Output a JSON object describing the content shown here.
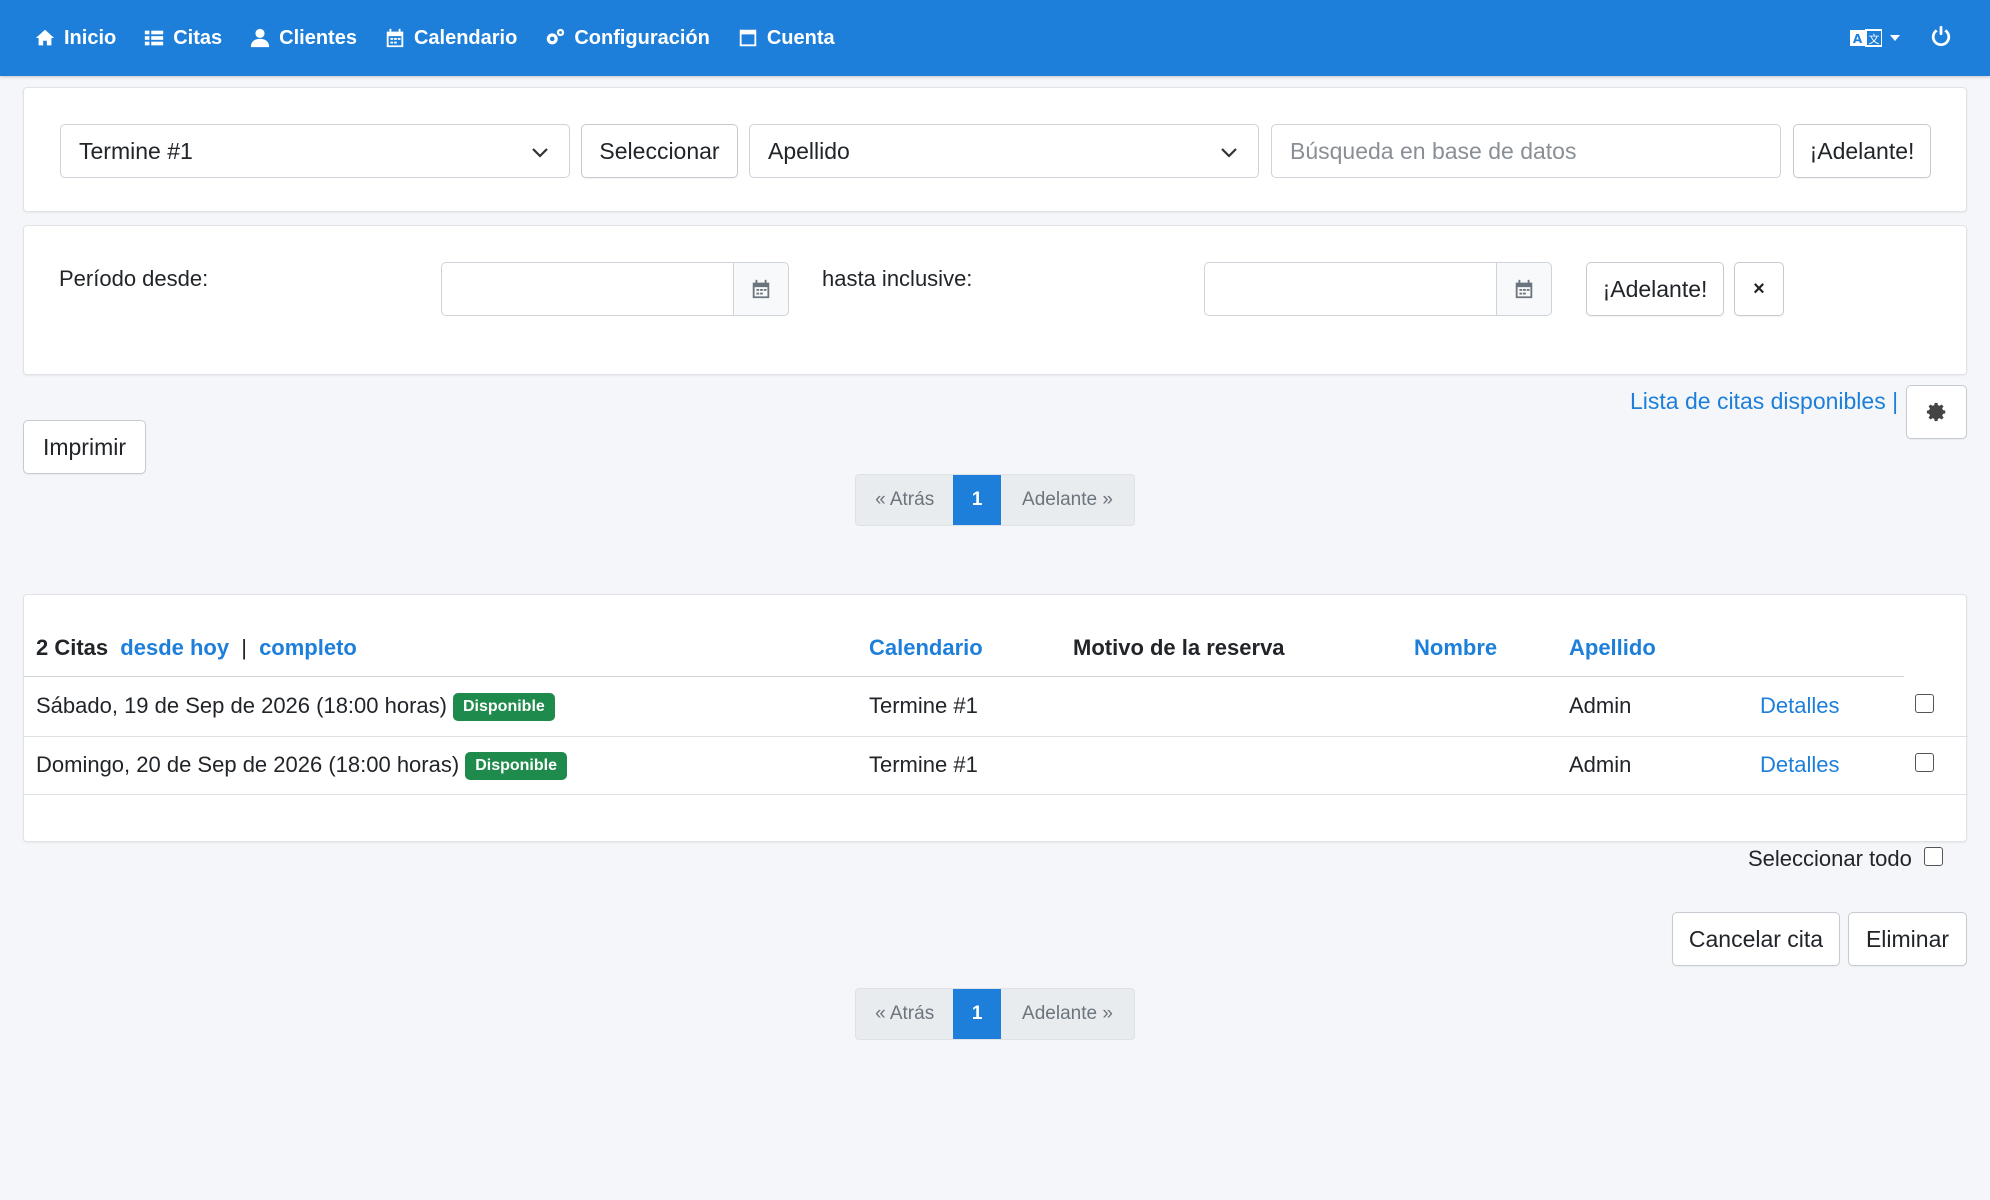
{
  "nav": {
    "items": [
      {
        "label": "Inicio",
        "icon": "home-icon"
      },
      {
        "label": "Citas",
        "icon": "list-icon"
      },
      {
        "label": "Clientes",
        "icon": "user-icon"
      },
      {
        "label": "Calendario",
        "icon": "calendar-icon"
      },
      {
        "label": "Configuración",
        "icon": "cogs-icon"
      },
      {
        "label": "Cuenta",
        "icon": "window-icon"
      }
    ],
    "language_icon": "language-icon",
    "power_icon": "power-icon"
  },
  "search": {
    "calendar_select": "Termine #1",
    "select_button": "Seleccionar",
    "field_select": "Apellido",
    "db_search_placeholder": "Búsqueda en base de datos",
    "go_button": "¡Adelante!"
  },
  "period": {
    "from_label": "Período desde:",
    "to_label": "hasta inclusive:",
    "from_value": "",
    "to_value": "",
    "go_button": "¡Adelante!",
    "clear_button": "×"
  },
  "toolbar": {
    "print_button": "Imprimir",
    "available_link": "Lista de citas disponibles",
    "separator": "|"
  },
  "pagination": {
    "prev": "« Atrás",
    "current": "1",
    "next": "Adelante »"
  },
  "table": {
    "count_label": "2 Citas",
    "filter_today": "desde hoy",
    "filter_sep": "|",
    "filter_all": "completo",
    "headers": {
      "calendar": "Calendario",
      "reason": "Motivo de la reserva",
      "name": "Nombre",
      "surname": "Apellido"
    },
    "rows": [
      {
        "date": "Sábado, 19 de Sep de 2026 (18:00 horas)",
        "status": "Disponible",
        "calendar": "Termine #1",
        "reason": "",
        "name": "",
        "surname": "Admin",
        "details": "Detalles"
      },
      {
        "date": "Domingo, 20 de Sep de 2026 (18:00 horas)",
        "status": "Disponible",
        "calendar": "Termine #1",
        "reason": "",
        "name": "",
        "surname": "Admin",
        "details": "Detalles"
      }
    ],
    "select_all_label": "Seleccionar todo"
  },
  "actions": {
    "cancel_button": "Cancelar cita",
    "delete_button": "Eliminar"
  },
  "colors": {
    "primary": "#1d7fd9",
    "badge": "#1e8a4c"
  }
}
